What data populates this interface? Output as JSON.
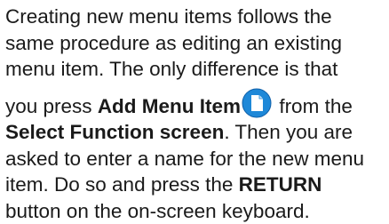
{
  "paragraph": {
    "line1": "Creating new menu items follows the",
    "line2": "same procedure as editing an existing",
    "line3": "menu item. The only difference is that",
    "line4_pre": "you press ",
    "line4_bold": "Add Menu Item",
    "line4_post": " from the",
    "line5_bold": "Select Function screen",
    "line5_post": ". Then you are",
    "line6": "asked to enter a name for the new menu",
    "line7_pre": "item. Do so and press the ",
    "line7_bold": "RETURN",
    "line8": "button on the on-screen keyboard."
  },
  "icons": {
    "add_menu_item": "document-icon",
    "add_menu_item_color": "#1e88d8"
  }
}
